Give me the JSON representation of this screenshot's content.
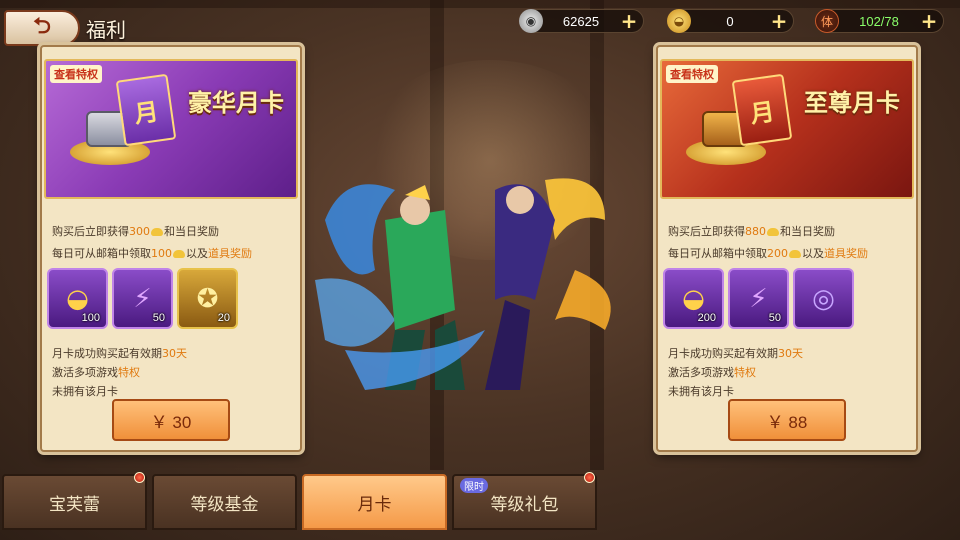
{
  "header": {
    "back_icon": "back-arrow-icon",
    "title": "福利"
  },
  "resources": {
    "coin": {
      "value": "62625",
      "icon": "silver-coin-icon"
    },
    "ingot": {
      "value": "0",
      "icon": "gold-ingot-icon"
    },
    "stamina": {
      "label": "体",
      "value": "102/78",
      "icon": "stamina-icon"
    },
    "plus": "+"
  },
  "cards": [
    {
      "tag": "查看特权",
      "title": "豪华月卡",
      "month_glyph": "月",
      "theme_color": "#8a3bb5",
      "line1_pre": "购买后立即获得",
      "line1_amount": "300",
      "line1_post": "和当日奖励",
      "line2_pre": "每日可从邮箱中领取",
      "line2_amount": "100",
      "line2_mid": "以及",
      "line2_link": "道具奖励",
      "items": [
        {
          "icon": "gold-ingot-icon",
          "qty": "100",
          "rarity": "purple"
        },
        {
          "icon": "purple-crystal-icon",
          "qty": "50",
          "rarity": "purple"
        },
        {
          "icon": "gold-medallion-icon",
          "qty": "20",
          "rarity": "gold"
        }
      ],
      "validity_pre": "月卡成功购买起有效期",
      "validity_days": "30天",
      "activate_pre": "激活多项游戏",
      "activate_link": "特权",
      "status": "未拥有该月卡",
      "price": "￥ 30"
    },
    {
      "tag": "查看特权",
      "title": "至尊月卡",
      "month_glyph": "月",
      "theme_color": "#b5301c",
      "line1_pre": "购买后立即获得",
      "line1_amount": "880",
      "line1_post": "和当日奖励",
      "line2_pre": "每日可从邮箱中领取",
      "line2_amount": "200",
      "line2_mid": "以及",
      "line2_link": "道具奖励",
      "items": [
        {
          "icon": "gold-ingot-icon",
          "qty": "200",
          "rarity": "purple"
        },
        {
          "icon": "purple-crystal-icon",
          "qty": "50",
          "rarity": "purple"
        },
        {
          "icon": "purple-orb-icon",
          "qty": "",
          "rarity": "purple"
        }
      ],
      "validity_pre": "月卡成功购买起有效期",
      "validity_days": "30天",
      "activate_pre": "激活多项游戏",
      "activate_link": "特权",
      "status": "未拥有该月卡",
      "price": "￥ 88"
    }
  ],
  "tabs": [
    {
      "label": "宝芙蕾",
      "active": false,
      "badge": true
    },
    {
      "label": "等级基金",
      "active": false,
      "badge": false
    },
    {
      "label": "月卡",
      "active": true,
      "badge": false
    },
    {
      "label": "等级礼包",
      "active": false,
      "badge": true,
      "tag": "限时"
    }
  ],
  "colors": {
    "accent_orange": "#f0903a",
    "highlight_text": "#e07a10",
    "panel_bg": "#f3e5c4"
  }
}
